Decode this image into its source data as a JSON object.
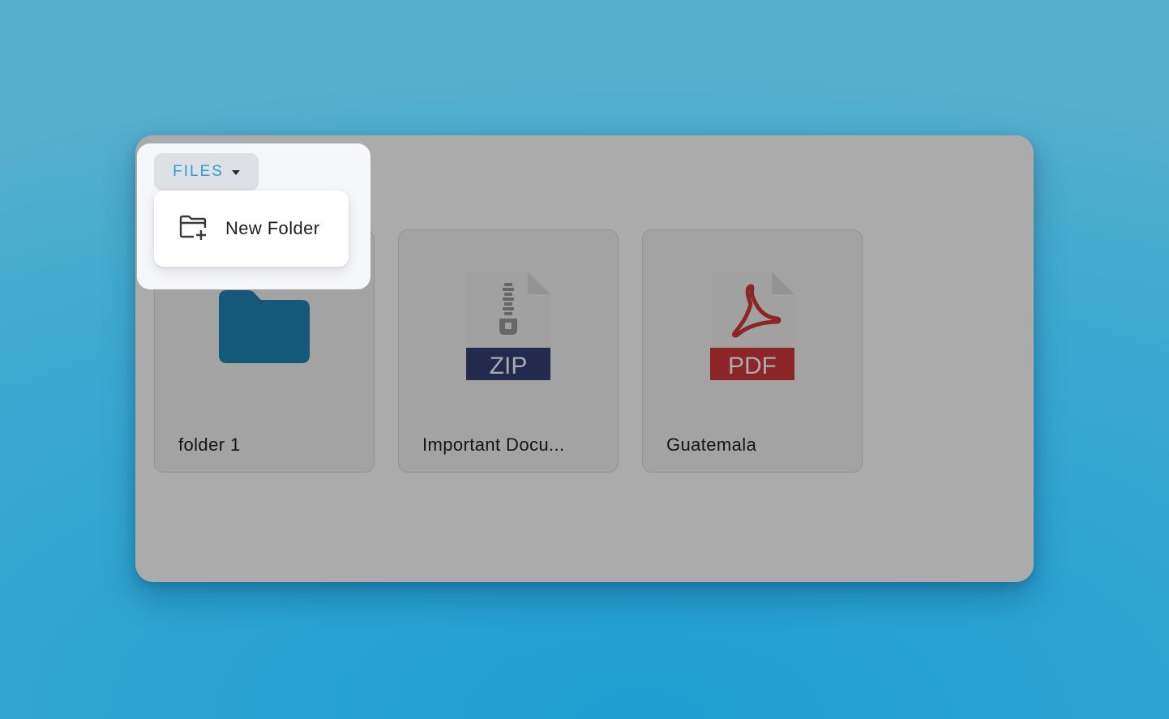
{
  "files_menu": {
    "button_label": "FILES",
    "caret_icon": "caret-down-icon",
    "items": [
      {
        "label": "New Folder",
        "icon": "new-folder-icon"
      }
    ]
  },
  "files": [
    {
      "name": "folder 1",
      "type": "folder",
      "icon": "folder-icon"
    },
    {
      "name": "Important Docu...",
      "type": "zip",
      "icon": "zip-file-icon",
      "badge": "ZIP"
    },
    {
      "name": "Guatemala",
      "type": "pdf",
      "icon": "pdf-file-icon",
      "badge": "PDF"
    }
  ],
  "colors": {
    "accent": "#2f9ed1",
    "folder": "#1f86b4",
    "zip_badge": "#353f73",
    "pdf_badge": "#d0383d",
    "pdf_glyph": "#d0383d"
  }
}
